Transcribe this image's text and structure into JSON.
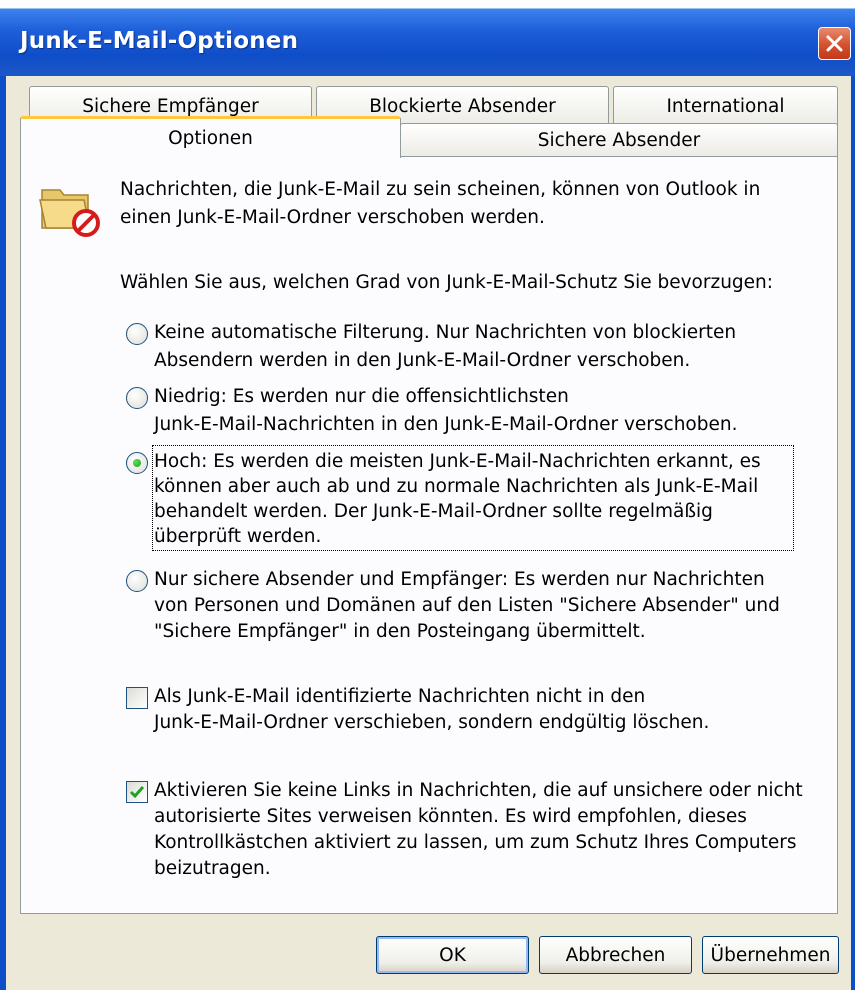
{
  "window": {
    "title": "Junk-E-Mail-Optionen"
  },
  "tabs": {
    "back_row": [
      "Sichere Empfänger",
      "Blockierte Absender",
      "International"
    ],
    "front_row": [
      "Optionen",
      "Sichere Absender"
    ],
    "active": "Optionen"
  },
  "intro": {
    "line1": "Nachrichten, die Junk-E-Mail zu sein scheinen, können von Outlook in",
    "line2": "einen Junk-E-Mail-Ordner verschoben werden."
  },
  "prompt": "Wählen Sie aus, welchen Grad von Junk-E-Mail-Schutz Sie bevorzugen:",
  "options": [
    {
      "lines": [
        "Keine automatische Filterung. Nur Nachrichten von blockierten",
        "Absendern werden in den Junk-E-Mail-Ordner verschoben."
      ],
      "checked": false
    },
    {
      "lines": [
        "Niedrig: Es werden nur die offensichtlichsten",
        "Junk-E-Mail-Nachrichten in den Junk-E-Mail-Ordner verschoben."
      ],
      "checked": false
    },
    {
      "lines": [
        "Hoch: Es werden die meisten Junk-E-Mail-Nachrichten erkannt, es",
        "können aber auch ab und zu normale Nachrichten als Junk-E-Mail",
        "behandelt werden. Der Junk-E-Mail-Ordner sollte regelmäßig",
        "überprüft werden."
      ],
      "checked": true
    },
    {
      "lines": [
        "Nur sichere Absender und Empfänger: Es werden nur Nachrichten",
        "von Personen und Domänen auf den Listen \"Sichere Absender\" und",
        "\"Sichere Empfänger\" in den Posteingang übermittelt."
      ],
      "checked": false
    }
  ],
  "checkboxes": [
    {
      "lines": [
        "Als Junk-E-Mail identifizierte Nachrichten nicht in den",
        "Junk-E-Mail-Ordner verschieben, sondern endgültig löschen."
      ],
      "checked": false
    },
    {
      "lines": [
        "Aktivieren Sie keine Links in Nachrichten, die auf unsichere oder nicht",
        "autorisierte Sites verweisen könnten. Es wird empfohlen, dieses",
        "Kontrollkästchen aktiviert zu lassen, um zum Schutz Ihres Computers",
        "beizutragen."
      ],
      "checked": true
    }
  ],
  "buttons": {
    "ok": "OK",
    "cancel": "Abbrechen",
    "apply": "Übernehmen"
  },
  "icons": {
    "folder": "junk-folder-icon",
    "close": "close-icon"
  },
  "colors": {
    "titlebar": "#0f4ec9",
    "active_tab_accent": "#ffc83c",
    "radio_dot": "#2fb02f",
    "checkmark": "#21a121"
  }
}
